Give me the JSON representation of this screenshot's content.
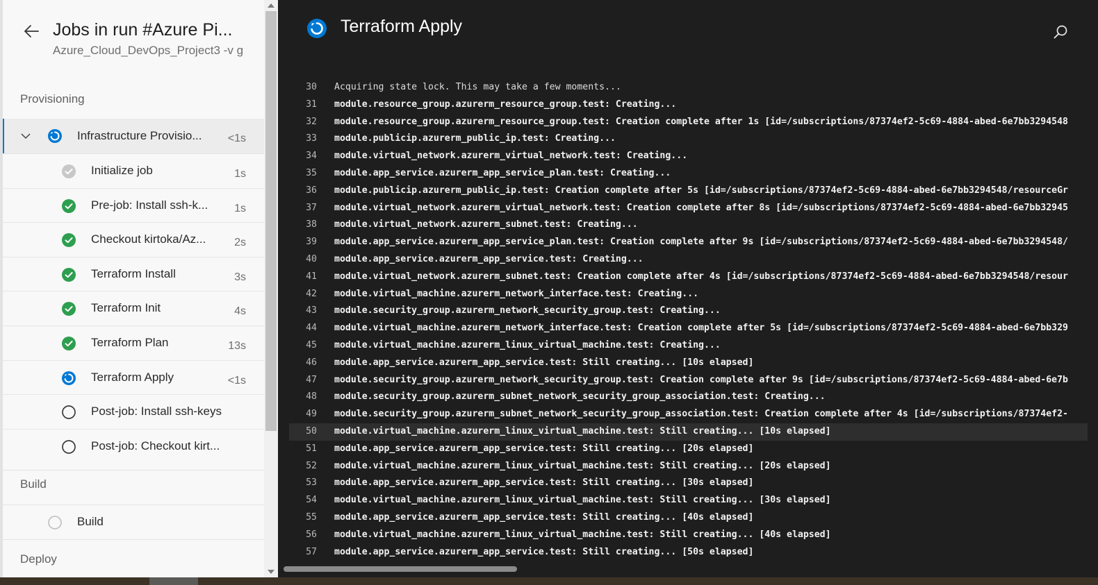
{
  "header": {
    "back_icon": "arrow-left-icon",
    "title": "Jobs in run #Azure Pi...",
    "subtitle": "Azure_Cloud_DevOps_Project3 -v g"
  },
  "stages": {
    "provisioning": "Provisioning",
    "build": "Build",
    "deploy": "Deploy"
  },
  "job": {
    "label": "Infrastructure Provisio...",
    "duration": "<1s",
    "status": "running"
  },
  "steps": [
    {
      "label": "Initialize job",
      "duration": "1s",
      "status": "skipped"
    },
    {
      "label": "Pre-job: Install ssh-k...",
      "duration": "1s",
      "status": "success"
    },
    {
      "label": "Checkout kirtoka/Az...",
      "duration": "2s",
      "status": "success"
    },
    {
      "label": "Terraform Install",
      "duration": "3s",
      "status": "success"
    },
    {
      "label": "Terraform Init",
      "duration": "4s",
      "status": "success"
    },
    {
      "label": "Terraform Plan",
      "duration": "13s",
      "status": "success"
    },
    {
      "label": "Terraform Apply",
      "duration": "<1s",
      "status": "running"
    },
    {
      "label": "Post-job: Install ssh-keys",
      "duration": "",
      "status": "pending"
    },
    {
      "label": "Post-job: Checkout kirt...",
      "duration": "",
      "status": "pending"
    }
  ],
  "build_job": {
    "label": "Build",
    "status": "queued"
  },
  "log_view": {
    "title": "Terraform Apply",
    "search_icon": "search-icon",
    "highlighted_line": 50,
    "lines": [
      {
        "n": "30",
        "t": "Acquiring state lock. This may take a few moments..."
      },
      {
        "n": "31",
        "t": "module.resource_group.azurerm_resource_group.test: Creating..."
      },
      {
        "n": "32",
        "t": "module.resource_group.azurerm_resource_group.test: Creation complete after 1s [id=/subscriptions/87374ef2-5c69-4884-abed-6e7bb3294548"
      },
      {
        "n": "33",
        "t": "module.publicip.azurerm_public_ip.test: Creating..."
      },
      {
        "n": "34",
        "t": "module.virtual_network.azurerm_virtual_network.test: Creating..."
      },
      {
        "n": "35",
        "t": "module.app_service.azurerm_app_service_plan.test: Creating..."
      },
      {
        "n": "36",
        "t": "module.publicip.azurerm_public_ip.test: Creation complete after 5s [id=/subscriptions/87374ef2-5c69-4884-abed-6e7bb3294548/resourceGr"
      },
      {
        "n": "37",
        "t": "module.virtual_network.azurerm_virtual_network.test: Creation complete after 8s [id=/subscriptions/87374ef2-5c69-4884-abed-6e7bb32945"
      },
      {
        "n": "38",
        "t": "module.virtual_network.azurerm_subnet.test: Creating..."
      },
      {
        "n": "39",
        "t": "module.app_service.azurerm_app_service_plan.test: Creation complete after 9s [id=/subscriptions/87374ef2-5c69-4884-abed-6e7bb3294548/"
      },
      {
        "n": "40",
        "t": "module.app_service.azurerm_app_service.test: Creating..."
      },
      {
        "n": "41",
        "t": "module.virtual_network.azurerm_subnet.test: Creation complete after 4s [id=/subscriptions/87374ef2-5c69-4884-abed-6e7bb3294548/resour"
      },
      {
        "n": "42",
        "t": "module.virtual_machine.azurerm_network_interface.test: Creating..."
      },
      {
        "n": "43",
        "t": "module.security_group.azurerm_network_security_group.test: Creating..."
      },
      {
        "n": "44",
        "t": "module.virtual_machine.azurerm_network_interface.test: Creation complete after 5s [id=/subscriptions/87374ef2-5c69-4884-abed-6e7bb329"
      },
      {
        "n": "45",
        "t": "module.virtual_machine.azurerm_linux_virtual_machine.test: Creating..."
      },
      {
        "n": "46",
        "t": "module.app_service.azurerm_app_service.test: Still creating... [10s elapsed]"
      },
      {
        "n": "47",
        "t": "module.security_group.azurerm_network_security_group.test: Creation complete after 9s [id=/subscriptions/87374ef2-5c69-4884-abed-6e7b"
      },
      {
        "n": "48",
        "t": "module.security_group.azurerm_subnet_network_security_group_association.test: Creating..."
      },
      {
        "n": "49",
        "t": "module.security_group.azurerm_subnet_network_security_group_association.test: Creation complete after 4s [id=/subscriptions/87374ef2-"
      },
      {
        "n": "50",
        "t": "module.virtual_machine.azurerm_linux_virtual_machine.test: Still creating... [10s elapsed]"
      },
      {
        "n": "51",
        "t": "module.app_service.azurerm_app_service.test: Still creating... [20s elapsed]"
      },
      {
        "n": "52",
        "t": "module.virtual_machine.azurerm_linux_virtual_machine.test: Still creating... [20s elapsed]"
      },
      {
        "n": "53",
        "t": "module.app_service.azurerm_app_service.test: Still creating... [30s elapsed]"
      },
      {
        "n": "54",
        "t": "module.virtual_machine.azurerm_linux_virtual_machine.test: Still creating... [30s elapsed]"
      },
      {
        "n": "55",
        "t": "module.app_service.azurerm_app_service.test: Still creating... [40s elapsed]"
      },
      {
        "n": "56",
        "t": "module.virtual_machine.azurerm_linux_virtual_machine.test: Still creating... [40s elapsed]"
      },
      {
        "n": "57",
        "t": "module.app_service.azurerm_app_service.test: Still creating... [50s elapsed]"
      }
    ]
  },
  "colors": {
    "accent": "#0078d4",
    "success": "#2e9e4f",
    "log_background": "#1e1e1e",
    "panel_background": "#f8f8f8"
  }
}
